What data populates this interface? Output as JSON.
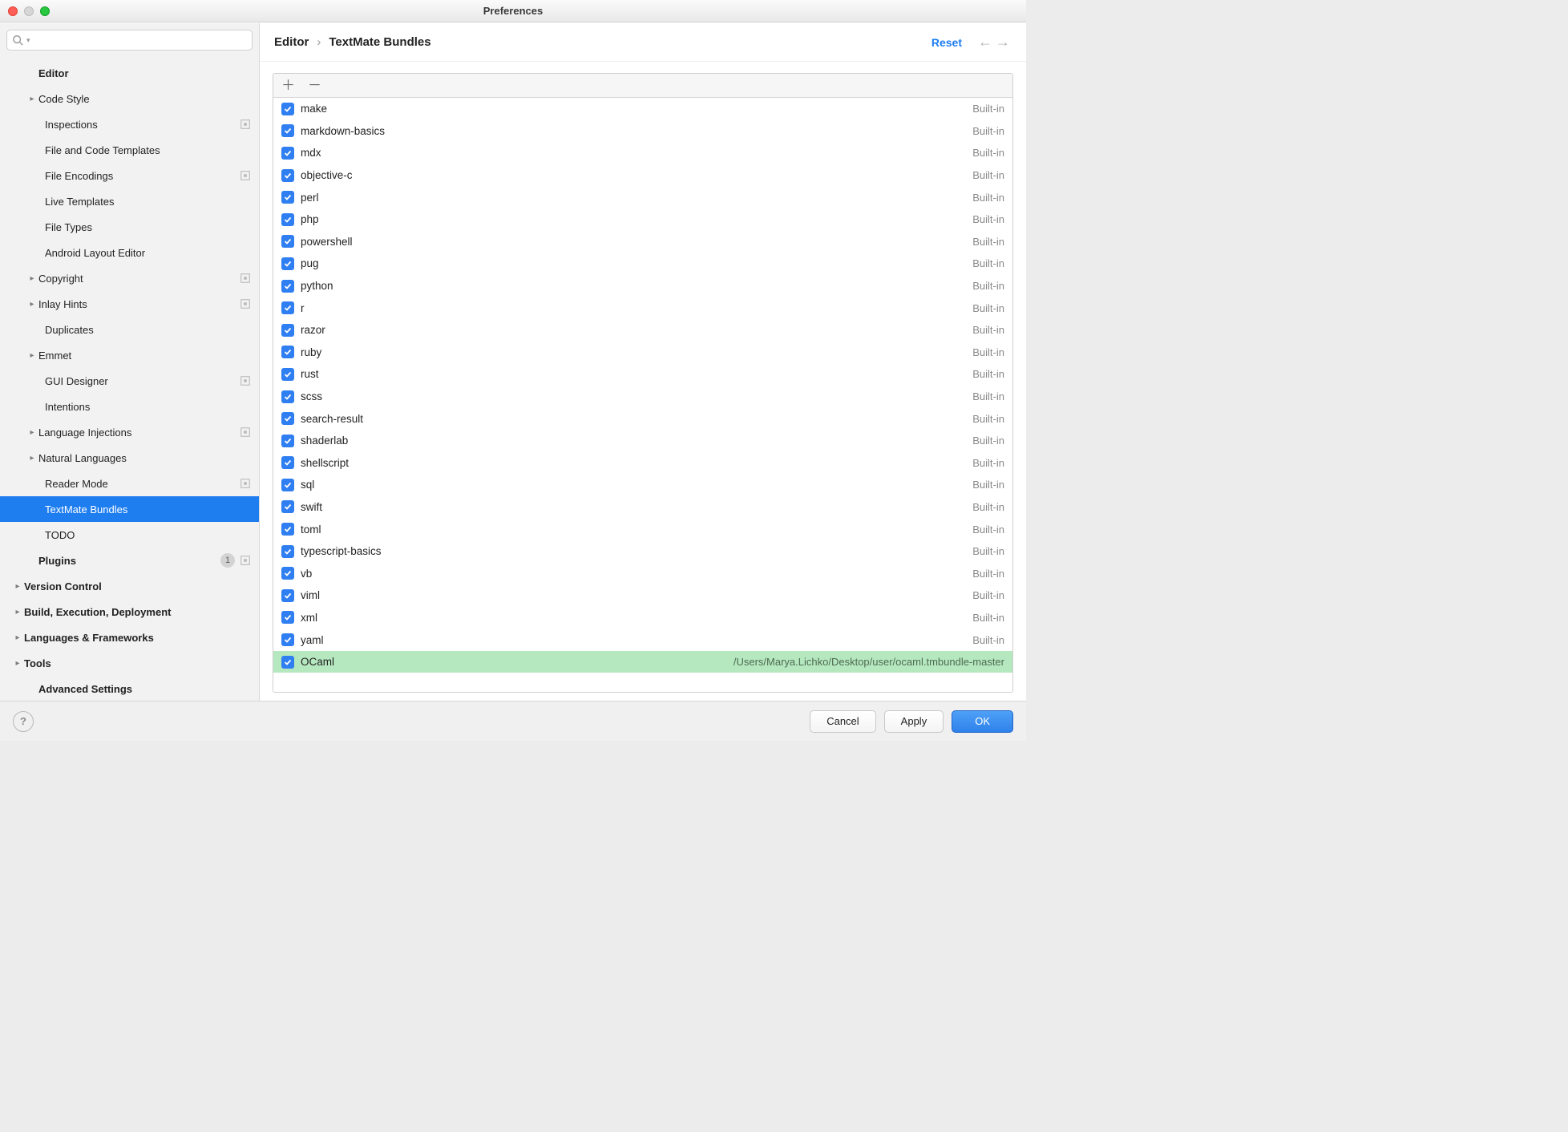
{
  "window": {
    "title": "Preferences"
  },
  "search": {
    "placeholder": ""
  },
  "breadcrumb": {
    "root": "Editor",
    "sep": "›",
    "leaf": "TextMate Bundles"
  },
  "actions": {
    "reset": "Reset"
  },
  "sidebar": {
    "editor": "Editor",
    "code_style": "Code Style",
    "inspections": "Inspections",
    "file_code_templates": "File and Code Templates",
    "file_encodings": "File Encodings",
    "live_templates": "Live Templates",
    "file_types": "File Types",
    "android_layout": "Android Layout Editor",
    "copyright": "Copyright",
    "inlay_hints": "Inlay Hints",
    "duplicates": "Duplicates",
    "emmet": "Emmet",
    "gui_designer": "GUI Designer",
    "intentions": "Intentions",
    "lang_injections": "Language Injections",
    "natural_languages": "Natural Languages",
    "reader_mode": "Reader Mode",
    "textmate_bundles": "TextMate Bundles",
    "todo": "TODO",
    "plugins": "Plugins",
    "plugins_badge": "1",
    "version_control": "Version Control",
    "build": "Build, Execution, Deployment",
    "langs_frameworks": "Languages & Frameworks",
    "tools": "Tools",
    "advanced": "Advanced Settings"
  },
  "bundles": [
    {
      "name": "make",
      "src": "Built-in"
    },
    {
      "name": "markdown-basics",
      "src": "Built-in"
    },
    {
      "name": "mdx",
      "src": "Built-in"
    },
    {
      "name": "objective-c",
      "src": "Built-in"
    },
    {
      "name": "perl",
      "src": "Built-in"
    },
    {
      "name": "php",
      "src": "Built-in"
    },
    {
      "name": "powershell",
      "src": "Built-in"
    },
    {
      "name": "pug",
      "src": "Built-in"
    },
    {
      "name": "python",
      "src": "Built-in"
    },
    {
      "name": "r",
      "src": "Built-in"
    },
    {
      "name": "razor",
      "src": "Built-in"
    },
    {
      "name": "ruby",
      "src": "Built-in"
    },
    {
      "name": "rust",
      "src": "Built-in"
    },
    {
      "name": "scss",
      "src": "Built-in"
    },
    {
      "name": "search-result",
      "src": "Built-in"
    },
    {
      "name": "shaderlab",
      "src": "Built-in"
    },
    {
      "name": "shellscript",
      "src": "Built-in"
    },
    {
      "name": "sql",
      "src": "Built-in"
    },
    {
      "name": "swift",
      "src": "Built-in"
    },
    {
      "name": "toml",
      "src": "Built-in"
    },
    {
      "name": "typescript-basics",
      "src": "Built-in"
    },
    {
      "name": "vb",
      "src": "Built-in"
    },
    {
      "name": "viml",
      "src": "Built-in"
    },
    {
      "name": "xml",
      "src": "Built-in"
    },
    {
      "name": "yaml",
      "src": "Built-in"
    },
    {
      "name": "OCaml",
      "src": "/Users/Marya.Lichko/Desktop/user/ocaml.tmbundle-master",
      "hl": true
    }
  ],
  "footer": {
    "cancel": "Cancel",
    "apply": "Apply",
    "ok": "OK"
  }
}
